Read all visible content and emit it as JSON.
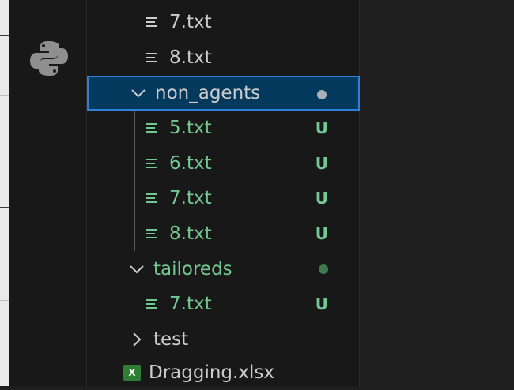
{
  "colors": {
    "untracked_green": "#73c991",
    "selected_bg": "#04395e",
    "selected_border": "#2f7fd6",
    "dot_grey": "#aab0ba",
    "dot_green": "#3f7a4f"
  },
  "tree": [
    {
      "label": "7.txt",
      "icon": "file-lines-icon",
      "status": "",
      "color": "default"
    },
    {
      "label": "8.txt",
      "icon": "file-lines-icon",
      "status": "",
      "color": "default"
    },
    {
      "label": "non_agents",
      "icon": "chevron-down-icon",
      "status": "dot",
      "color": "default",
      "selected": true
    },
    {
      "label": "5.txt",
      "icon": "file-lines-icon",
      "status": "U",
      "color": "green"
    },
    {
      "label": "6.txt",
      "icon": "file-lines-icon",
      "status": "U",
      "color": "green"
    },
    {
      "label": "7.txt",
      "icon": "file-lines-icon",
      "status": "U",
      "color": "green"
    },
    {
      "label": "8.txt",
      "icon": "file-lines-icon",
      "status": "U",
      "color": "green"
    },
    {
      "label": "tailoreds",
      "icon": "chevron-down-icon",
      "status": "dot",
      "color": "green"
    },
    {
      "label": "7.txt",
      "icon": "file-lines-icon",
      "status": "U",
      "color": "green"
    },
    {
      "label": "test",
      "icon": "chevron-right-icon",
      "status": "",
      "color": "default"
    },
    {
      "label": "Dragging.xlsx",
      "icon": "excel-file-icon",
      "status": "",
      "color": "default"
    }
  ]
}
